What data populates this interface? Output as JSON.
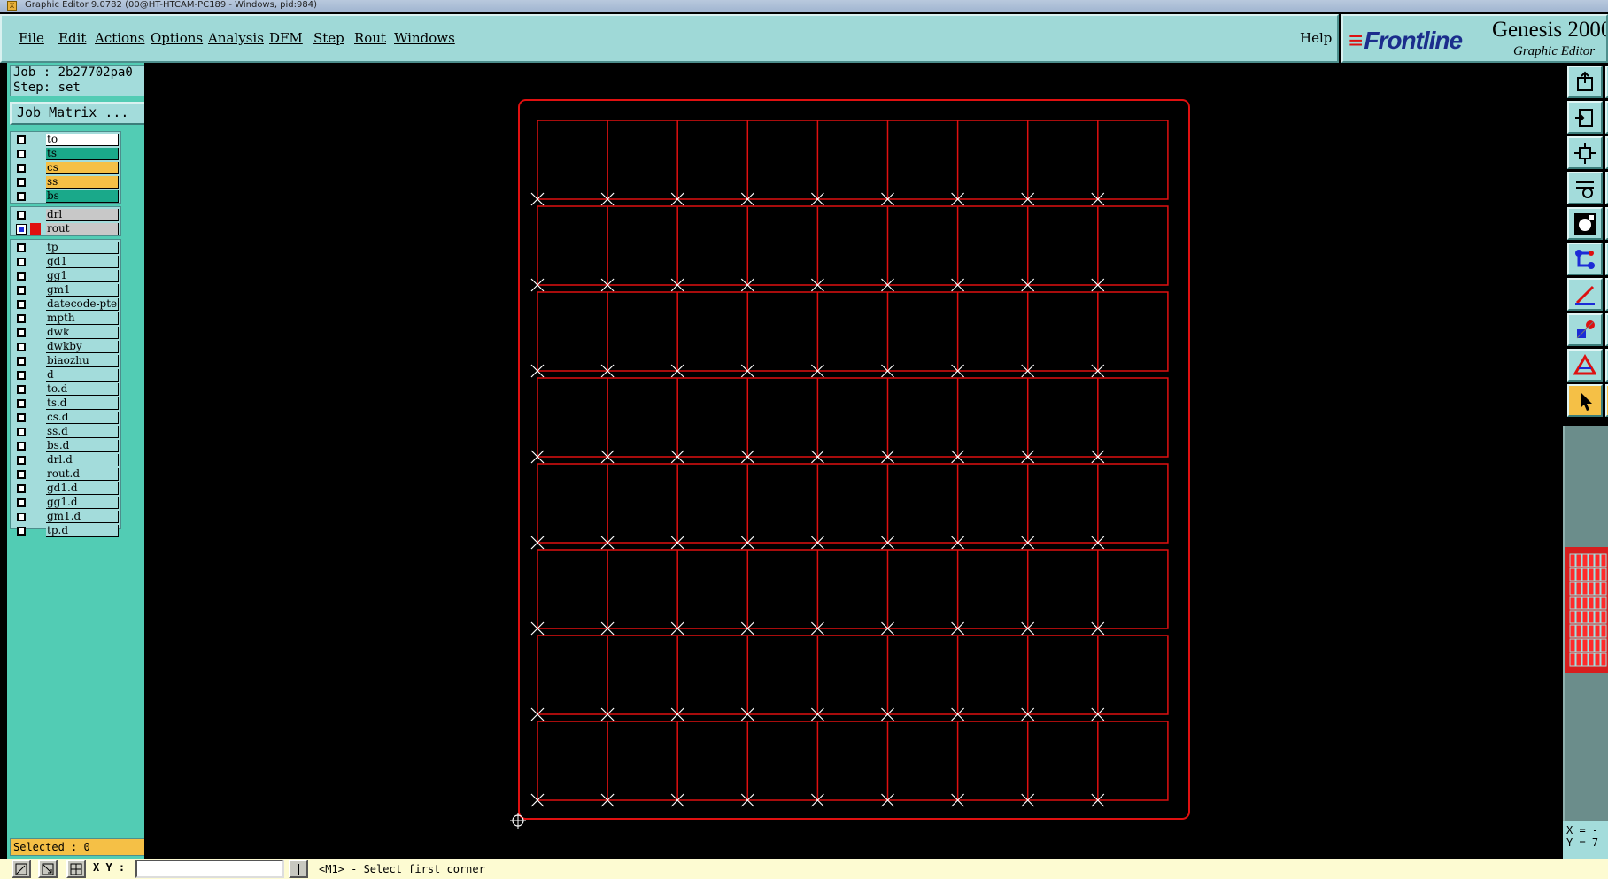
{
  "window": {
    "title": "Graphic Editor 9.0782 (00@HT-HTCAM-PC189 - Windows, pid:984)"
  },
  "menu": {
    "items": [
      "File",
      "Edit",
      "Actions",
      "Options",
      "Analysis",
      "DFM",
      "Step",
      "Rout",
      "Windows"
    ],
    "help": "Help"
  },
  "brand": {
    "logo": "Frontline",
    "product": "Genesis 2000",
    "subtitle": "Graphic Editor"
  },
  "job": {
    "job_line": "Job : 2b27702pa0",
    "step_line": "Step: set",
    "matrix_button": "Job Matrix ..."
  },
  "layers": {
    "board": [
      {
        "name": "to",
        "color": "#ffffff",
        "checked": false
      },
      {
        "name": "ts",
        "color": "#1aa98a",
        "checked": false
      },
      {
        "name": "cs",
        "color": "#f5c046",
        "checked": false
      },
      {
        "name": "ss",
        "color": "#f5c046",
        "checked": false
      },
      {
        "name": "bs",
        "color": "#1aa98a",
        "checked": false
      }
    ],
    "drill": [
      {
        "name": "drl",
        "color": "#c8c8c8",
        "checked": false,
        "swatch": ""
      },
      {
        "name": "rout",
        "color": "#c8c8c8",
        "checked": true,
        "swatch": "#e01010"
      }
    ],
    "misc": [
      "tp",
      "gd1",
      "gg1",
      "gm1",
      "datecode-pte",
      "mpth",
      "dwk",
      "dwkby",
      "biaozhu",
      "d",
      "to.d",
      "ts.d",
      "cs.d",
      "ss.d",
      "bs.d",
      "drl.d",
      "rout.d",
      "gd1.d",
      "gg1.d",
      "gm1.d",
      "tp.d"
    ]
  },
  "status": {
    "selected": "Selected : 0",
    "xy_label": "X Y :",
    "xy_value": "",
    "message": "<M1> - Select first corner",
    "coord_x": "X = -",
    "coord_y": "Y = 7"
  },
  "panel": {
    "rows": 8,
    "cols": 9
  },
  "colors": {
    "outline": "#e01010",
    "markers": "#ffffff",
    "panel_bg": "#52ccb4",
    "menu_bg": "#9fd9d7"
  },
  "icons": [
    "snapshot-icon",
    "fit-icon",
    "zoom-home-icon",
    "tools-icon",
    "display-icon",
    "connect-icon",
    "measure-icon",
    "snap-icon",
    "drc-icon",
    "pointer-icon"
  ]
}
